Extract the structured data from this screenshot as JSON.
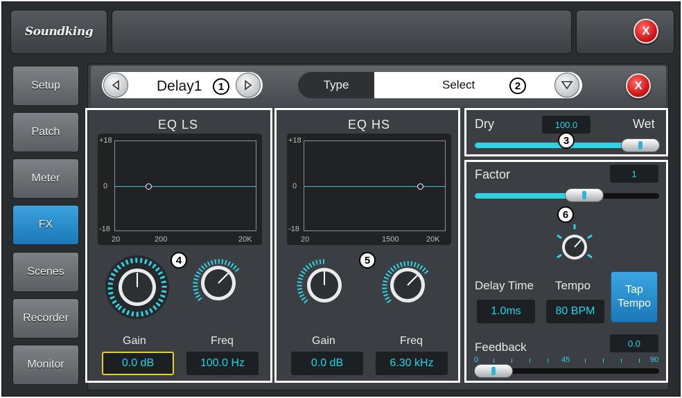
{
  "brand": {
    "logo": "Soundking"
  },
  "sidebar": {
    "items": [
      {
        "label": "Setup",
        "active": false
      },
      {
        "label": "Patch",
        "active": false
      },
      {
        "label": "Meter",
        "active": false
      },
      {
        "label": "FX",
        "active": true
      },
      {
        "label": "Scenes",
        "active": false
      },
      {
        "label": "Recorder",
        "active": false
      },
      {
        "label": "Monitor",
        "active": false
      }
    ]
  },
  "header": {
    "close_label": "X",
    "preset_name": "Delay1",
    "callout1": "1",
    "type_label": "Type",
    "select_label": "Select",
    "callout2": "2",
    "fx_close_label": "X"
  },
  "eq_ls": {
    "title": "EQ LS",
    "y_max": "+18",
    "y_mid": "0",
    "y_min": "-18",
    "x_labels": [
      "20",
      "200",
      "20K"
    ],
    "gain_label": "Gain",
    "gain_value": "0.0 dB",
    "freq_label": "Freq",
    "freq_value": "100.0 Hz",
    "callout": "4"
  },
  "eq_hs": {
    "title": "EQ HS",
    "y_max": "+18",
    "y_mid": "0",
    "y_min": "-18",
    "x_labels": [
      "20",
      "1500",
      "20K"
    ],
    "gain_label": "Gain",
    "gain_value": "0.0 dB",
    "freq_label": "Freq",
    "freq_value": "6.30 kHz",
    "callout": "5"
  },
  "mix": {
    "dry_label": "Dry",
    "wet_label": "Wet",
    "value": "100.0",
    "callout": "3",
    "level": 1.0
  },
  "delay": {
    "factor_label": "Factor",
    "factor_value": "1",
    "factor_level": 0.6,
    "callout": "6",
    "delay_time_label": "Delay Time",
    "delay_time_value": "1.0ms",
    "tempo_label": "Tempo",
    "tempo_value": "80 BPM",
    "tap_label_1": "Tap",
    "tap_label_2": "Tempo",
    "feedback_label": "Feedback",
    "feedback_value": "0.0",
    "feedback_level": 0.0,
    "scale": [
      "0",
      "45",
      "90"
    ]
  },
  "colors": {
    "accent": "#2ed4e4",
    "active": "#1b78b8",
    "close": "#d11818"
  }
}
